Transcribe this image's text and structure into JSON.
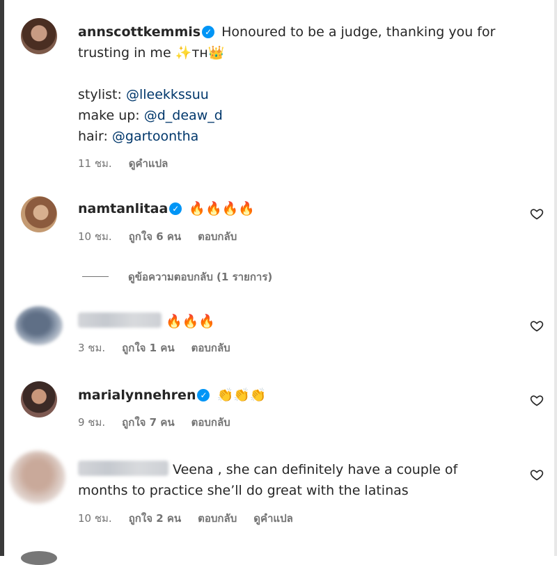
{
  "caption": {
    "username": "annscottkemmis",
    "text_line1": "Honoured to be a judge, thanking you for",
    "text_line2": "trusting in me",
    "emojis": "✨ᴛʜ👑",
    "credits": [
      {
        "label": "stylist: ",
        "mention": "@lleekkssuu"
      },
      {
        "label": "make up: ",
        "mention": "@d_deaw_d"
      },
      {
        "label": "hair: ",
        "mention": "@gartoontha"
      }
    ],
    "time": "11 ชม.",
    "translate": "ดูคำแปล"
  },
  "comments": [
    {
      "username": "namtanlitaa",
      "text": "🔥🔥🔥🔥",
      "time": "10 ชม.",
      "likes": "ถูกใจ 6 คน",
      "reply": "ตอบกลับ"
    },
    {
      "username": "",
      "text": "🔥🔥🔥",
      "time": "3 ชม.",
      "likes": "ถูกใจ 1 คน",
      "reply": "ตอบกลับ"
    },
    {
      "username": "marialynnehren",
      "text": "👏👏👏",
      "time": "9 ชม.",
      "likes": "ถูกใจ 7 คน",
      "reply": "ตอบกลับ"
    },
    {
      "username": "",
      "text_line1": "Veena , she can definitely have a couple of",
      "text_line2": "months to practice she’ll do great with the latinas",
      "time": "10 ชม.",
      "likes": "ถูกใจ 2 คน",
      "reply": "ตอบกลับ",
      "translate": "ดูคำแปล"
    }
  ],
  "view_replies": "ดูข้อความตอบกลับ (1 รายการ)",
  "icons": {
    "verified": "verified-badge-icon",
    "like": "heart-outline-icon"
  },
  "colors": {
    "verified": "#0095f6",
    "mention": "#00376b",
    "meta": "#737373"
  }
}
